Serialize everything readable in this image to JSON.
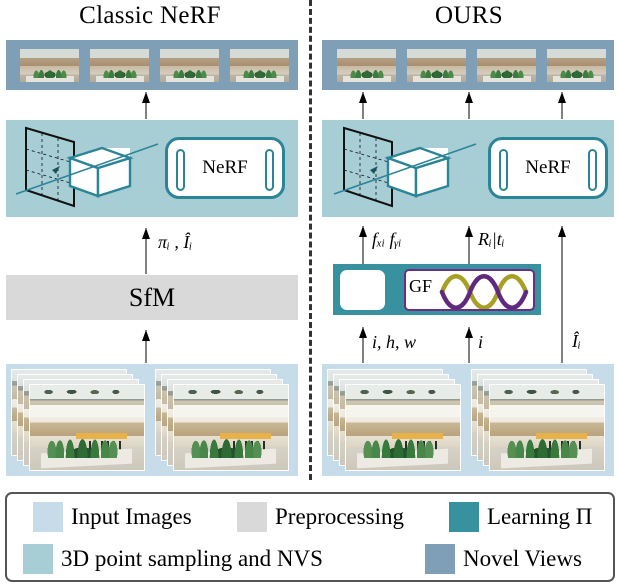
{
  "titles": {
    "left": "Classic NeRF",
    "right": "OURS"
  },
  "modules": {
    "nerf_label": "NeRF",
    "sfm_label": "SfM",
    "gf_label": "GF"
  },
  "arrow_labels": {
    "classic_sfm_out": "πᵢ , Îᵢ",
    "ours_focal": "fₓᵢ fᵧᵢ",
    "ours_pose": "Rᵢ|tᵢ",
    "ours_in_ihw": "i, h, w",
    "ours_in_i": "i",
    "ours_in_img": "Îᵢ"
  },
  "legend": {
    "row1": [
      {
        "label": "Input Images",
        "color": "#c6dde9"
      },
      {
        "label": "Preprocessing",
        "color": "#d9d9d9"
      },
      {
        "label": "Learning Π",
        "color": "#38919e"
      }
    ],
    "row2": [
      {
        "label": "3D point sampling and NVS",
        "color": "#a7cdd5"
      },
      {
        "label": "Novel Views",
        "color": "#7e9fb6"
      }
    ]
  },
  "colors": {
    "novel_views": "#7e9fb6",
    "nvs": "#a7cdd5",
    "preprocessing": "#d9d9d9",
    "input_images": "#c6dde9",
    "learning_pi": "#38919e",
    "nerf_border": "#2c8597",
    "gf_border": "#6b2f82",
    "gf_wave_a": "#a8a024",
    "gf_wave_b": "#5f2a7e"
  }
}
